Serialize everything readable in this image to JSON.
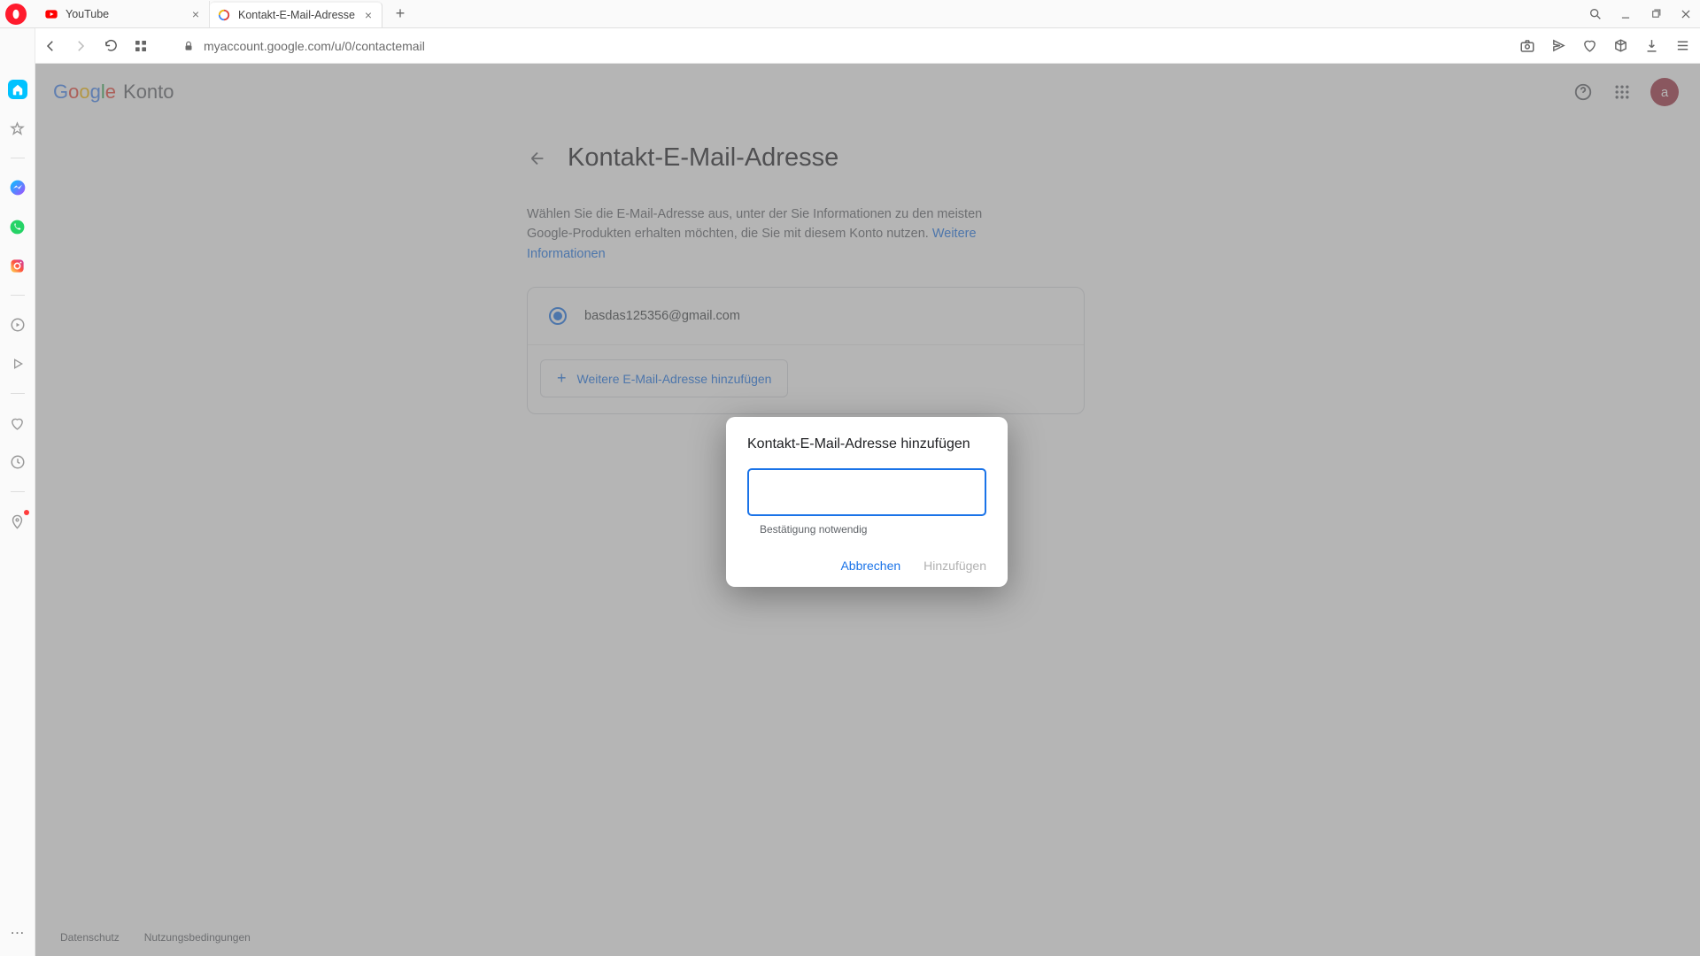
{
  "browser": {
    "tabs": [
      {
        "title": "YouTube",
        "favicon": "youtube"
      },
      {
        "title": "Kontakt-E-Mail-Adresse",
        "favicon": "google"
      }
    ],
    "url": "myaccount.google.com/u/0/contactemail"
  },
  "header": {
    "brand_google": "Google",
    "brand_konto": "Konto",
    "avatar_letter": "a"
  },
  "page": {
    "title": "Kontakt-E-Mail-Adresse",
    "description": "Wählen Sie die E-Mail-Adresse aus, unter der Sie Informationen zu den meisten Google-Produkten erhalten möchten, die Sie mit diesem Konto nutzen.",
    "learn_more": "Weitere Informationen",
    "selected_email": "basdas125356@gmail.com",
    "add_button": "Weitere E-Mail-Adresse hinzufügen"
  },
  "modal": {
    "title": "Kontakt-E-Mail-Adresse hinzufügen",
    "input_value": "",
    "hint": "Bestätigung notwendig",
    "cancel": "Abbrechen",
    "confirm": "Hinzufügen"
  },
  "footer": {
    "privacy": "Datenschutz",
    "terms": "Nutzungsbedingungen"
  }
}
